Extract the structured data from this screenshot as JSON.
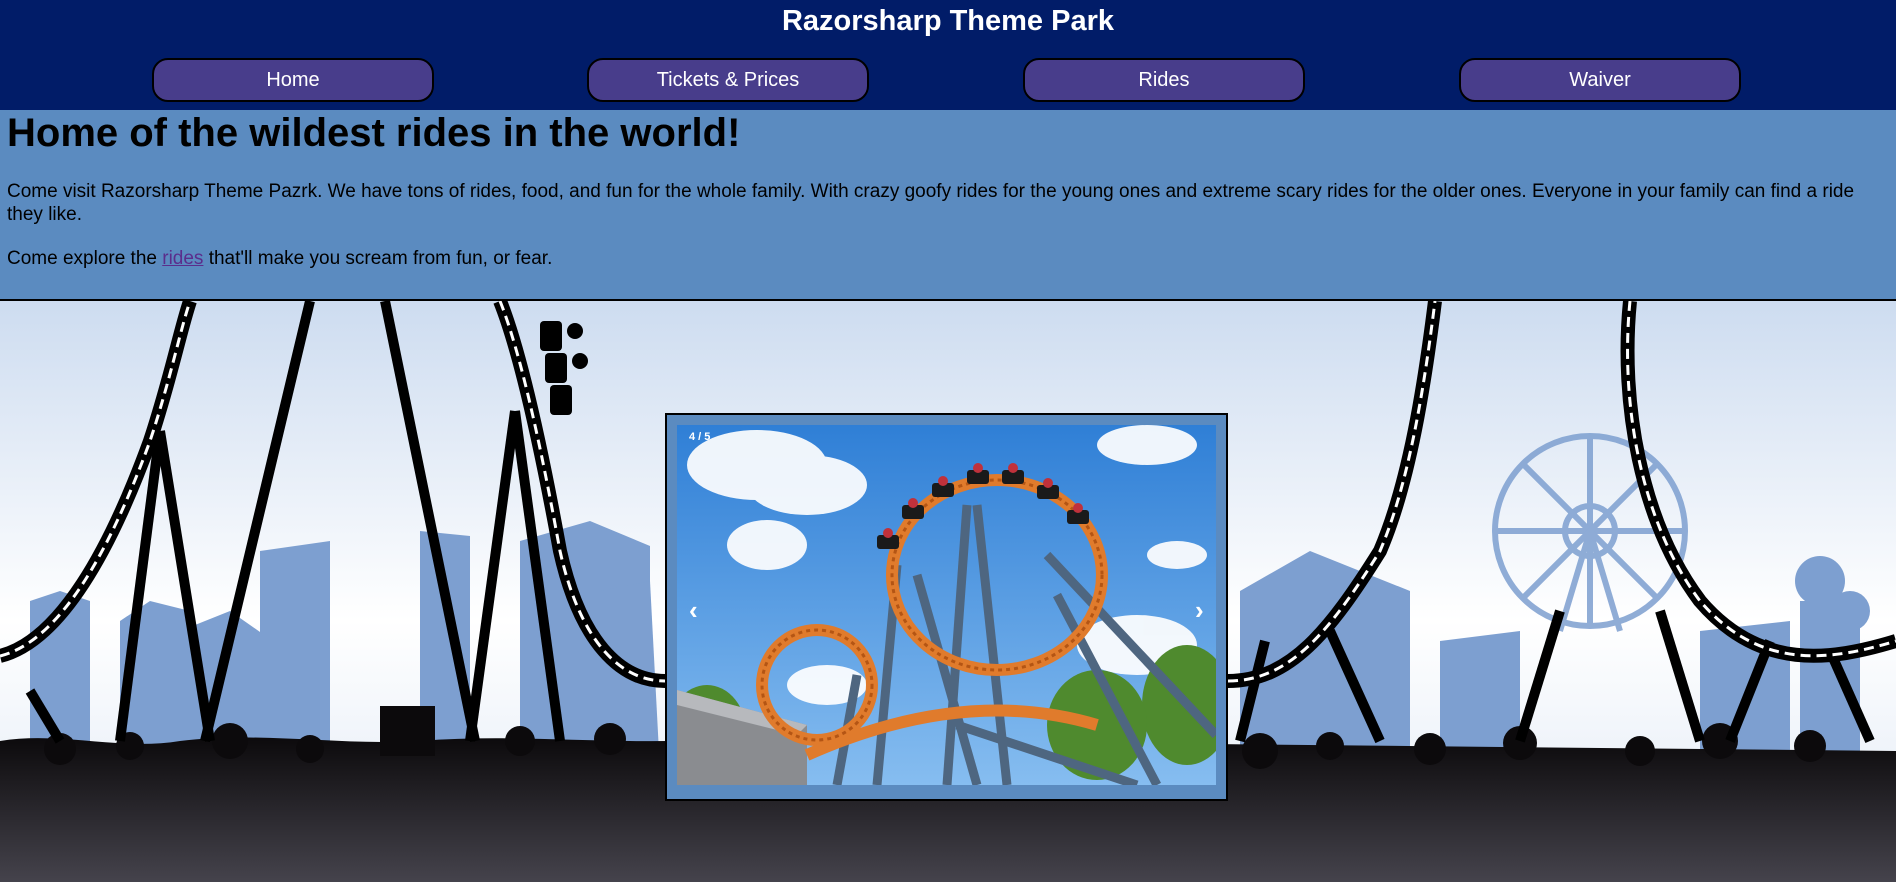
{
  "header": {
    "title": "Razorsharp Theme Park",
    "background_color": "#011c68",
    "nav": [
      {
        "label": "Home"
      },
      {
        "label": "Tickets & Prices"
      },
      {
        "label": "Rides"
      },
      {
        "label": "Waiver"
      }
    ],
    "nav_button_color": "#483d8b"
  },
  "intro": {
    "heading": "Home of the wildest rides in the world!",
    "paragraph1": "Come visit Razorsharp Theme Pazrk. We have tons of rides, food, and fun for the whole family. With crazy goofy rides for the young ones and extreme scary rides for the older ones. Everyone in your family can find a ride they like.",
    "paragraph2_before": "Come explore the ",
    "paragraph2_link": "rides",
    "paragraph2_after": " that'll make you scream from fun, or fear.",
    "background_color": "#5b8bc0"
  },
  "slideshow": {
    "counter": "4 / 5",
    "prev_icon": "‹",
    "next_icon": "›",
    "current_slide": 4,
    "total_slides": 5
  }
}
